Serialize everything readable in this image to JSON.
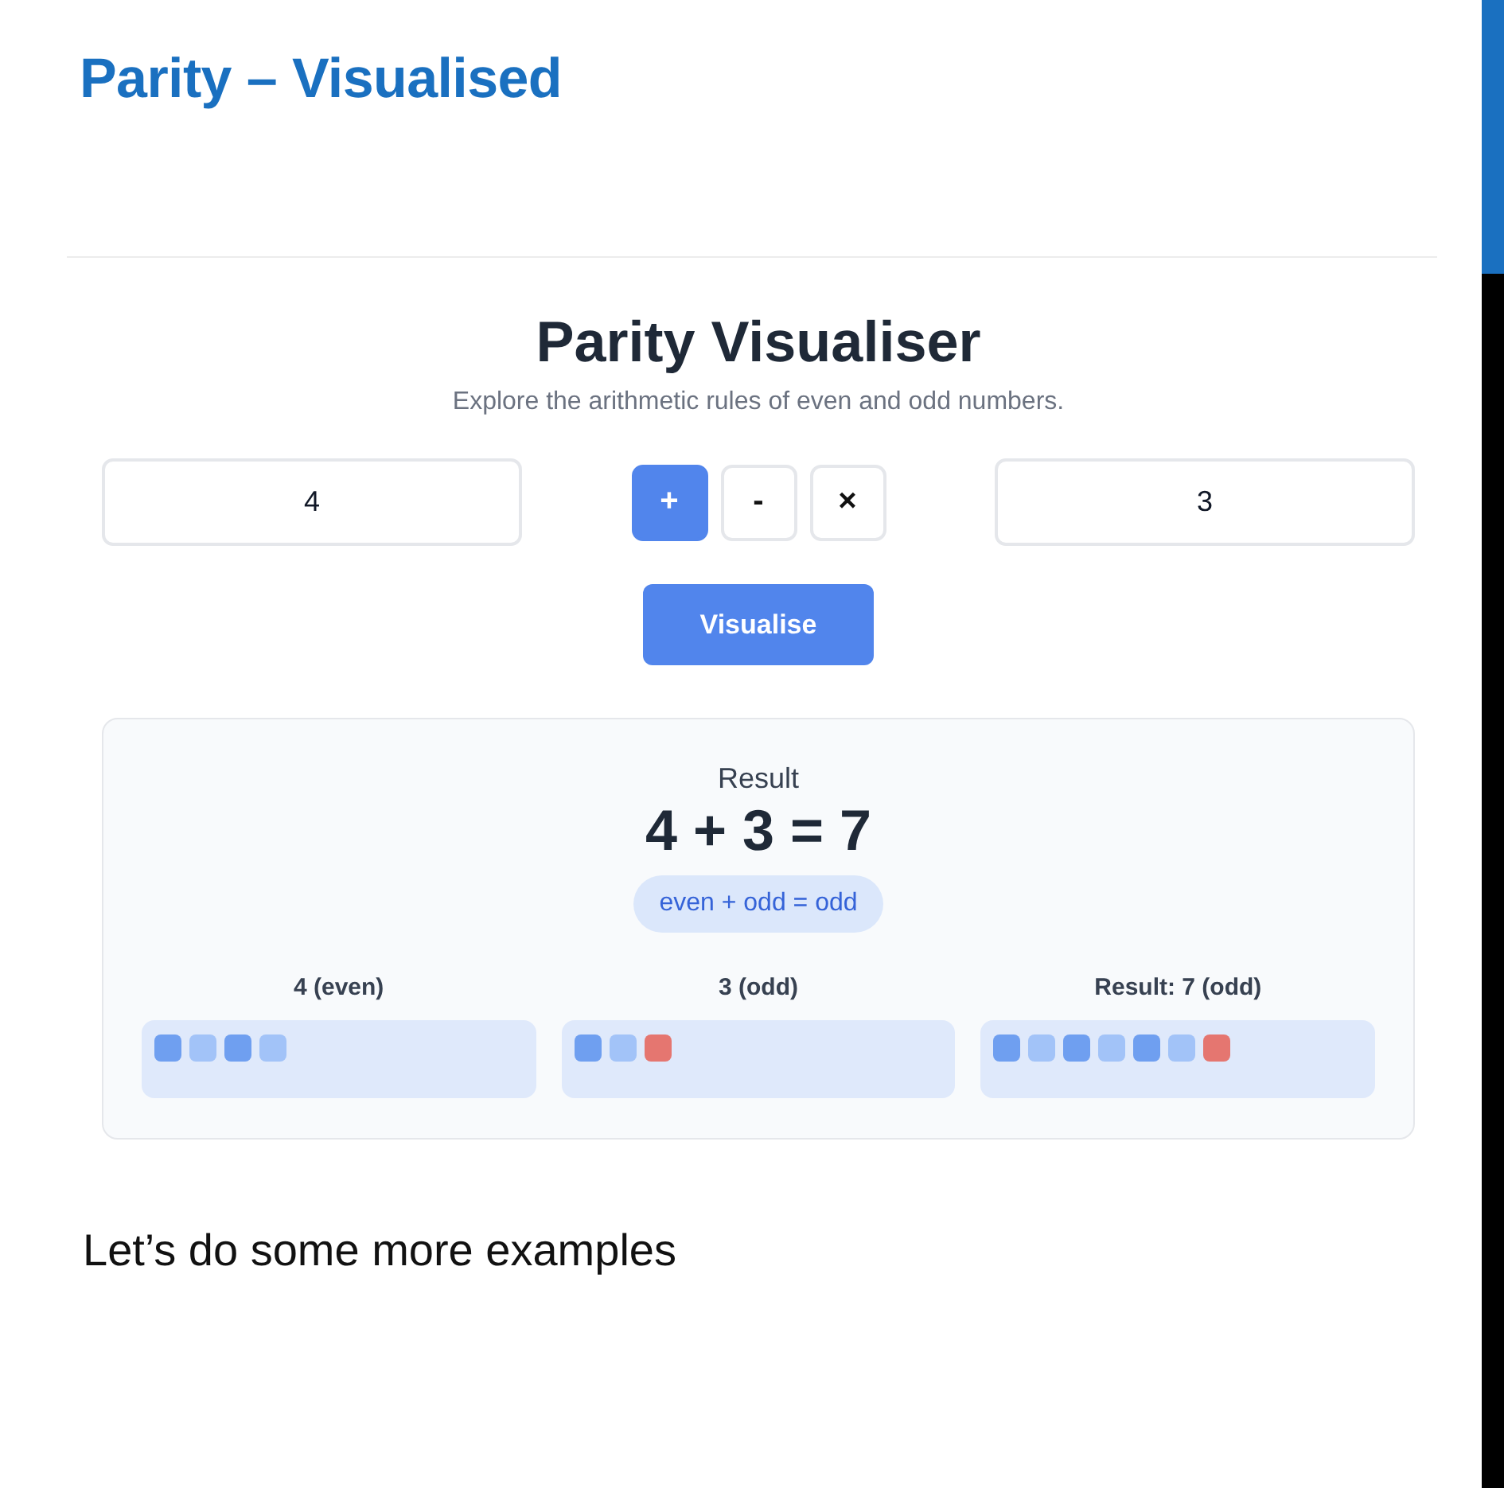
{
  "slide": {
    "title": "Parity – Visualised"
  },
  "app": {
    "title": "Parity Visualiser",
    "subtitle": "Explore the arithmetic rules of even and odd numbers.",
    "first_number": {
      "value": "4"
    },
    "operators": [
      {
        "label": "+",
        "selected": true
      },
      {
        "label": "-",
        "selected": false
      },
      {
        "label": "×",
        "selected": false
      }
    ],
    "second_number": {
      "value": "3"
    },
    "visualise_button": "Visualise",
    "result": {
      "heading": "Result",
      "equation": "4 + 3 = 7",
      "rule": "even + odd = odd",
      "groups": [
        {
          "label": "4 (even)",
          "blocks": [
            {
              "color": "#6f9ff0"
            },
            {
              "color": "#a2c3f8"
            },
            {
              "color": "#6f9ff0"
            },
            {
              "color": "#a2c3f8"
            }
          ]
        },
        {
          "label": "3 (odd)",
          "blocks": [
            {
              "color": "#6f9ff0"
            },
            {
              "color": "#a2c3f8"
            },
            {
              "color": "#e57670"
            }
          ]
        },
        {
          "label": "Result: 7 (odd)",
          "blocks": [
            {
              "color": "#6f9ff0"
            },
            {
              "color": "#a2c3f8"
            },
            {
              "color": "#6f9ff0"
            },
            {
              "color": "#a2c3f8"
            },
            {
              "color": "#6f9ff0"
            },
            {
              "color": "#a2c3f8"
            },
            {
              "color": "#e57670"
            }
          ]
        }
      ]
    }
  },
  "caption": "Let’s do some more examples"
}
